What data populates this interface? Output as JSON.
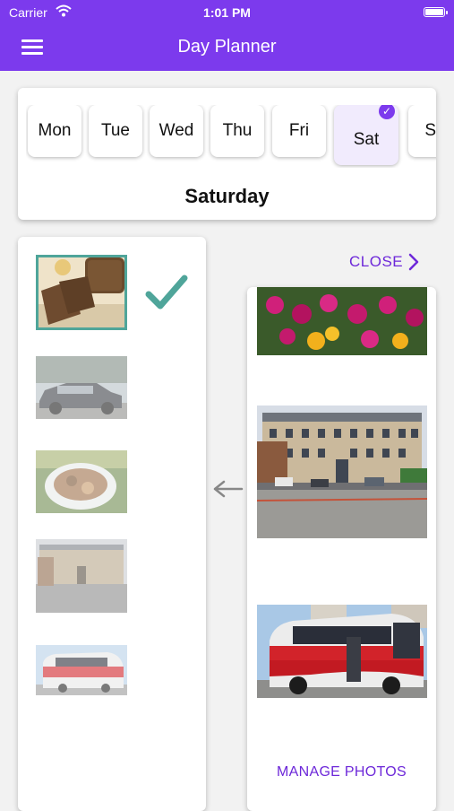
{
  "status": {
    "carrier": "Carrier",
    "time": "1:01 PM"
  },
  "nav": {
    "title": "Day Planner"
  },
  "days": [
    "Mon",
    "Tue",
    "Wed",
    "Thu",
    "Fri",
    "Sat",
    "Su"
  ],
  "selected_day": {
    "short": "Sat",
    "full": "Saturday"
  },
  "actions": {
    "close": "CLOSE",
    "manage": "MANAGE PHOTOS"
  },
  "colors": {
    "accent": "#7c3aed",
    "check": "#4fa59a"
  },
  "photos": {
    "day_list": [
      "bread",
      "car",
      "food-plate",
      "building",
      "bus"
    ],
    "library": [
      "flowers",
      "building",
      "bus"
    ]
  }
}
